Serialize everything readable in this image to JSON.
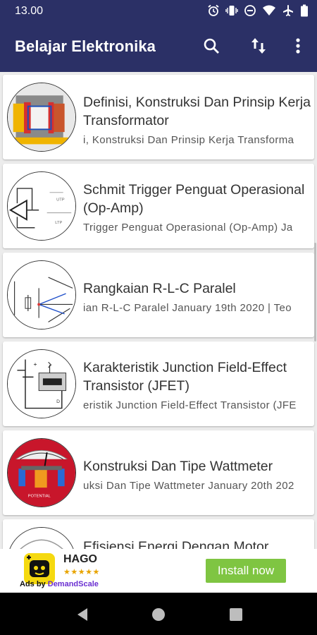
{
  "status_bar": {
    "time": "13.00",
    "icons": [
      "alarm-icon",
      "vibrate-icon",
      "do-not-disturb-icon",
      "wifi-icon",
      "airplane-icon",
      "battery-icon"
    ]
  },
  "app_bar": {
    "title": "Belajar Elektronika",
    "background": "#2b3066",
    "actions": [
      "search-icon",
      "sort-icon",
      "more-vert-icon"
    ]
  },
  "articles": [
    {
      "title": "Definisi, Konstruksi Dan Prinsip Kerja Transformator",
      "subtitle": "i, Konstruksi Dan Prinsip Kerja Transforma",
      "thumbnail": "transformer-image"
    },
    {
      "title": "Schmit Trigger Penguat Operasional (Op-Amp)",
      "subtitle": " Trigger Penguat Operasional (Op-Amp) Ja",
      "thumbnail": "op-amp-circuit-image"
    },
    {
      "title": "Rangkaian R-L-C Paralel",
      "subtitle": "ian R-L-C Paralel January 19th 2020 | Teo",
      "thumbnail": "rlc-diagram-image"
    },
    {
      "title": "Karakteristik Junction Field-Effect Transistor (JFET)",
      "subtitle": "eristik Junction Field-Effect Transistor (JFE",
      "thumbnail": "jfet-circuit-image"
    },
    {
      "title": "Konstruksi Dan Tipe Wattmeter",
      "subtitle": "uksi Dan Tipe Wattmeter January 20th 202",
      "thumbnail": "wattmeter-image"
    },
    {
      "title": "Efisiensi Energi Dengan Motor",
      "subtitle": "",
      "thumbnail": "motor-image"
    }
  ],
  "ad": {
    "app_name": "HAGO",
    "stars": "★★★★★",
    "ads_by": "Ads by",
    "provider": "DemandScale",
    "install_label": "Install now",
    "install_color": "#7fc542"
  },
  "nav_bar": {
    "buttons": [
      "back-icon",
      "home-icon",
      "recents-icon"
    ]
  }
}
